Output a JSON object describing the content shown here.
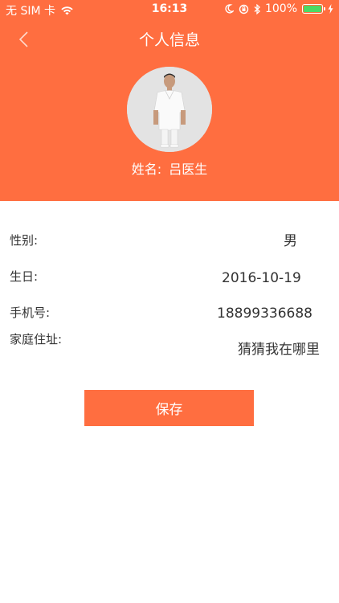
{
  "status_bar": {
    "carrier": "无 SIM 卡",
    "time": "16:13",
    "battery": "100%",
    "battery_color": "#4CD964"
  },
  "nav": {
    "title": "个人信息",
    "back_icon": "chevron-left-icon"
  },
  "profile": {
    "name_label": "姓名:",
    "name_value": "吕医生",
    "avatar_icon": "doctor-avatar"
  },
  "fields": [
    {
      "label": "性别:",
      "value": "男"
    },
    {
      "label": "生日:",
      "value": "2016-10-19"
    },
    {
      "label": "手机号:",
      "value": "18899336688"
    },
    {
      "label": "家庭住址:",
      "value": "猜猜我在哪里"
    }
  ],
  "actions": {
    "save_label": "保存"
  },
  "colors": {
    "accent": "#FF6E40",
    "text": "#333333",
    "background": "#ffffff"
  }
}
